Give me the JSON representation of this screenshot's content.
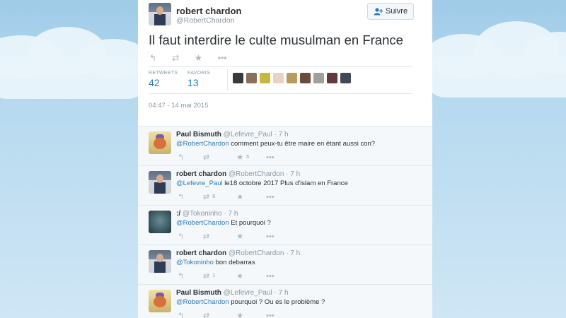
{
  "main_tweet": {
    "name": "robert chardon",
    "handle": "@RobertChardon",
    "follow_label": "Suivre",
    "text": "Il faut interdire le culte musulman en France",
    "stats": {
      "retweets_label": "RETWEETS",
      "retweets_value": "42",
      "favorites_label": "FAVORIS",
      "favorites_value": "13"
    },
    "timestamp": "04:47 - 14 mai 2015"
  },
  "replies": [
    {
      "name": "Paul Bismuth",
      "handle": "@Lefevre_Paul",
      "time": "· 7 h",
      "mention": "@RobertChardon",
      "text": " comment peux-tu être maire en étant aussi con?",
      "retweets": "",
      "favorites": "5"
    },
    {
      "name": "robert chardon",
      "handle": "@RobertChardon",
      "time": "· 7 h",
      "mention": "@Lefevre_Paul",
      "text": " le18 octobre 2017 Plus d'islam en France",
      "retweets": "6",
      "favorites": ""
    },
    {
      "name": ":/",
      "handle": "@Tokoninho",
      "time": "· 7 h",
      "mention": "@RobertChardon",
      "text": " Et pourquoi ?",
      "retweets": "",
      "favorites": ""
    },
    {
      "name": "robert chardon",
      "handle": "@RobertChardon",
      "time": "· 7 h",
      "mention": "@Tokoninho",
      "text": " bon debarras",
      "retweets": "1",
      "favorites": ""
    },
    {
      "name": "Paul Bismuth",
      "handle": "@Lefevre_Paul",
      "time": "· 7 h",
      "mention": "@RobertChardon",
      "text": " pourquoi ? Ou es le problème ?",
      "retweets": "",
      "favorites": ""
    }
  ],
  "icons": {
    "reply": "reply-icon",
    "retweet": "retweet-icon",
    "favorite": "star-icon",
    "more": "more-icon",
    "follow": "add-user-icon"
  },
  "colors": {
    "link": "#2b7bb9",
    "text": "#292f33",
    "muted": "#8899a6",
    "icon": "#aab8c2",
    "sky": "#b6d9ef"
  }
}
